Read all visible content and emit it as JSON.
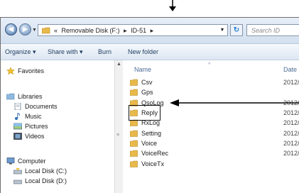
{
  "address": {
    "chevron": "«",
    "crumbs": [
      "Removable Disk (F:)",
      "ID-51"
    ],
    "separator": "▸"
  },
  "search": {
    "placeholder": "Search ID"
  },
  "toolbar": {
    "organize": "Organize ▾",
    "share": "Share with ▾",
    "burn": "Burn",
    "new_folder": "New folder"
  },
  "nav": {
    "favorites": "Favorites",
    "libraries": "Libraries",
    "documents": "Documents",
    "music": "Music",
    "pictures": "Pictures",
    "videos": "Videos",
    "computer": "Computer",
    "local_c": "Local Disk (C:)",
    "local_d": "Local Disk (D:)"
  },
  "columns": {
    "name": "Name",
    "date": "Date r"
  },
  "files": [
    {
      "name": "Csv",
      "date": "2012/"
    },
    {
      "name": "Gps",
      "date": ""
    },
    {
      "name": "QsoLog",
      "date": "2012/"
    },
    {
      "name": "Reply",
      "date": "2012/"
    },
    {
      "name": "RxLog",
      "date": "2012/"
    },
    {
      "name": "Setting",
      "date": "2012/"
    },
    {
      "name": "Voice",
      "date": "2012/"
    },
    {
      "name": "VoiceRec",
      "date": "2012/"
    },
    {
      "name": "VoiceTx",
      "date": ""
    }
  ],
  "colors": {
    "folder": "#e8b94a",
    "arrow": "#000000",
    "link": "#1e3a5f"
  }
}
